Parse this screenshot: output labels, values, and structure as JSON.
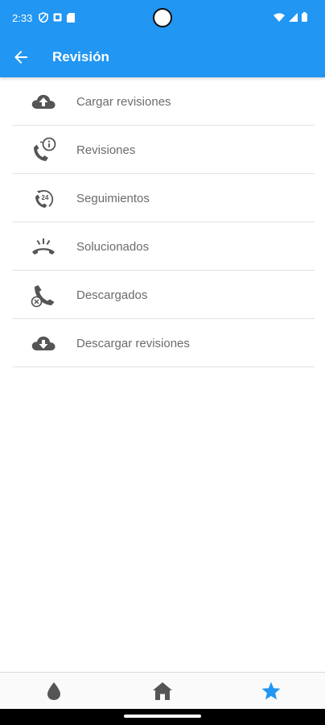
{
  "status_bar": {
    "time": "2:33",
    "left_icons": [
      "vpn-shield-icon",
      "notification-square-icon",
      "sim-card-icon"
    ],
    "right_icons": [
      "wifi-icon",
      "signal-icon",
      "battery-icon"
    ]
  },
  "appbar": {
    "title": "Revisión",
    "back_icon": "arrow-left-icon",
    "color": "#2196F3"
  },
  "menu": {
    "items": [
      {
        "label": "Cargar revisiones",
        "icon": "cloud-upload-icon"
      },
      {
        "label": "Revisiones",
        "icon": "phone-info-icon"
      },
      {
        "label": "Seguimientos",
        "icon": "phone-24h-icon"
      },
      {
        "label": "Solucionados",
        "icon": "phone-hangup-icon"
      },
      {
        "label": "Descargados",
        "icon": "phone-cancel-icon"
      },
      {
        "label": "Descargar revisiones",
        "icon": "cloud-download-icon"
      }
    ]
  },
  "bottom_nav": {
    "items": [
      {
        "icon": "water-drop-icon",
        "active": false
      },
      {
        "icon": "home-icon",
        "active": false
      },
      {
        "icon": "star-icon",
        "active": true
      }
    ],
    "active_color": "#2196F3",
    "inactive_color": "#555555"
  }
}
